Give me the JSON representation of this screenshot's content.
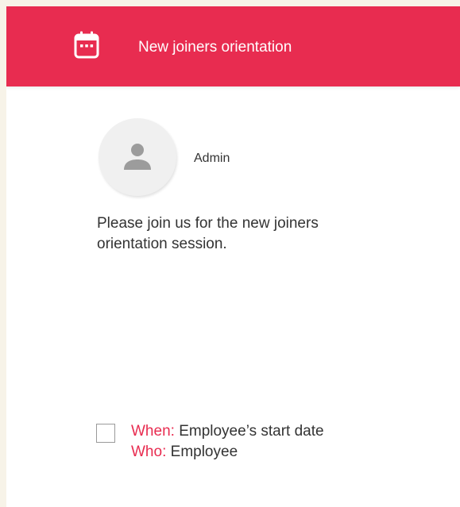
{
  "header": {
    "title": "New joiners orientation",
    "icon": "calendar-icon",
    "background_color": "#e82c50"
  },
  "author": {
    "avatar_icon": "user-icon",
    "name": "Admin"
  },
  "message": {
    "text": "Please join us for the new joiners orientation session."
  },
  "task": {
    "checked": false,
    "when_label": "When:",
    "when_value": "Employee’s start date",
    "who_label": "Who:",
    "who_value": "Employee",
    "label_color": "#e82c50"
  }
}
